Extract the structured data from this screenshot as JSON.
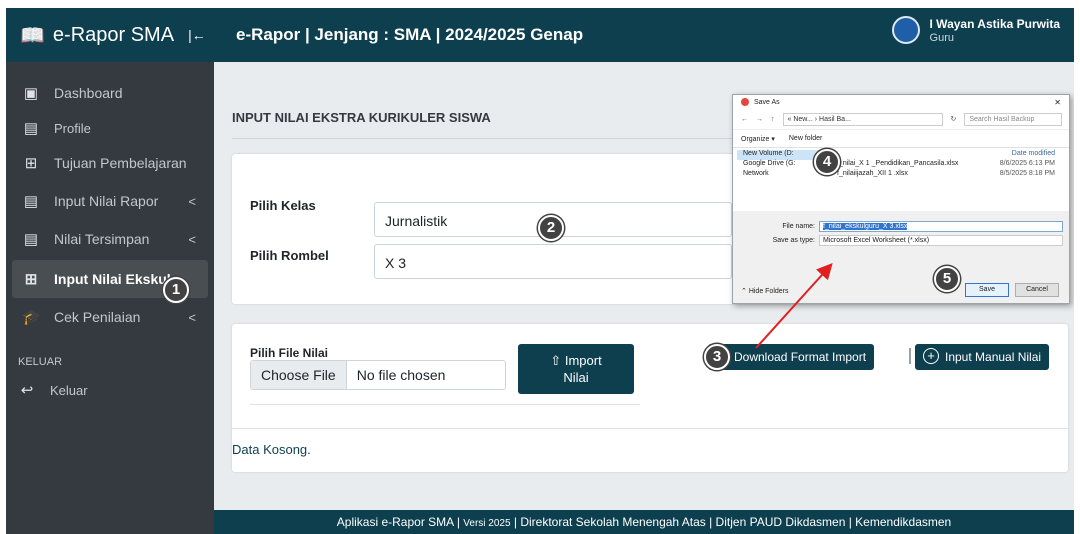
{
  "app": {
    "brand": "e-Rapor SMA",
    "collapse_icon": "collapse-left-icon"
  },
  "header": {
    "title": "e-Rapor | Jenjang : SMA | 2024/2025 Genap",
    "user_name": "I Wayan Astika Purwita",
    "user_role": "Guru"
  },
  "sidebar": {
    "items": [
      {
        "label": "Dashboard",
        "icon": "dashboard-icon"
      },
      {
        "label": "Profile",
        "icon": "id-card-icon"
      },
      {
        "label": "Tujuan Pembelajaran",
        "icon": "plus-square-icon"
      },
      {
        "label": "Input Nilai Rapor",
        "icon": "form-icon",
        "has_submenu": true
      },
      {
        "label": "Nilai Tersimpan",
        "icon": "form-icon",
        "has_submenu": true
      },
      {
        "label": "Input Nilai Ekskul",
        "icon": "plus-square-icon",
        "active": true
      },
      {
        "label": "Cek Penilaian",
        "icon": "graduation-cap-icon",
        "has_submenu": true
      }
    ],
    "section_label": "KELUAR",
    "logout_label": "Keluar"
  },
  "page": {
    "title": "INPUT NILAI EKSTRA KURIKULER SISWA"
  },
  "filters": {
    "kelas_label": "Pilih Kelas",
    "kelas_value": "Jurnalistik",
    "rombel_label": "Pilih Rombel",
    "rombel_value": "X 3"
  },
  "import": {
    "file_label": "Pilih File Nilai",
    "choose_file": "Choose File",
    "no_file": "No file chosen",
    "import_label_1": "Import",
    "import_label_2": "Nilai",
    "download_label": "Download Format Import",
    "manual_label": "Input Manual Nilai",
    "empty_text": "Data Kosong."
  },
  "footer": {
    "text_a": "Aplikasi e-Rapor SMA | ",
    "text_b": "Versi 2025",
    "text_c": " | Direktorat Sekolah Menengah Atas | Ditjen PAUD Dikdasmen | Kemendikdasmen"
  },
  "badges": [
    "1",
    "2",
    "3",
    "4",
    "5"
  ],
  "dialog": {
    "title": "Save As",
    "path": "« New... › Hasil Ba...",
    "search_placeholder": "Search Hasil Backup",
    "organize": "Organize ▾",
    "new_folder": "New folder",
    "nav": [
      "New Volume (D:",
      "Google Drive (G:",
      "Network"
    ],
    "date_header": "Date modified",
    "files": [
      {
        "name": "f_nilai_X 1 _Pendidikan_Pancasila.xlsx",
        "date": "8/6/2025 6:13 PM"
      },
      {
        "name": "f_nilaiijazah_XII 1 .xlsx",
        "date": "8/5/2025 8:18 PM"
      }
    ],
    "file_name_label": "File name:",
    "file_name_value": "f_nilai_ekskulguru_X 3.xlsx",
    "save_type_label": "Save as type:",
    "save_type_value": "Microsoft Excel Worksheet (*.xlsx)",
    "hide_folders": "Hide Folders",
    "save_label": "Save",
    "cancel_label": "Cancel"
  },
  "colors": {
    "primary": "#0d3f4f",
    "sidebar": "#343a40",
    "background": "#e9ecef"
  }
}
